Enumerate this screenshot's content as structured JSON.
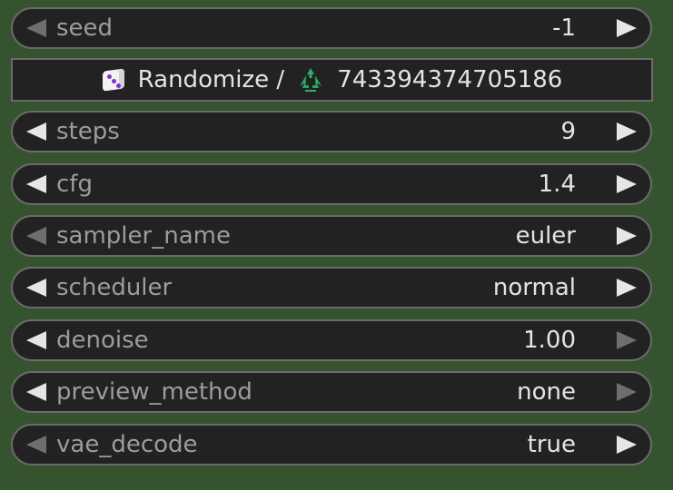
{
  "widgets": [
    {
      "name": "seed",
      "label": "seed",
      "value": "-1",
      "left_dim": true,
      "right_dim": false
    },
    {
      "name": "steps",
      "label": "steps",
      "value": "9",
      "left_dim": false,
      "right_dim": false
    },
    {
      "name": "cfg",
      "label": "cfg",
      "value": "1.4",
      "left_dim": false,
      "right_dim": false
    },
    {
      "name": "sampler-name",
      "label": "sampler_name",
      "value": "euler",
      "left_dim": true,
      "right_dim": false
    },
    {
      "name": "scheduler",
      "label": "scheduler",
      "value": "normal",
      "left_dim": false,
      "right_dim": false
    },
    {
      "name": "denoise",
      "label": "denoise",
      "value": "1.00",
      "left_dim": false,
      "right_dim": true
    },
    {
      "name": "preview-method",
      "label": "preview_method",
      "value": "none",
      "left_dim": false,
      "right_dim": true
    },
    {
      "name": "vae-decode",
      "label": "vae_decode",
      "value": "true",
      "left_dim": true,
      "right_dim": false
    }
  ],
  "randomize_button": {
    "label": "Randomize /",
    "seed_value": "743394374705186",
    "left_icon": "dice-icon",
    "right_icon": "recycle-icon"
  },
  "colors": {
    "background": "#35532f",
    "widget_bg": "#222222",
    "widget_border": "#6b6b6b",
    "label": "#9c9c9c",
    "value": "#e4e4e4",
    "arrow_active": "#e6e6e6",
    "arrow_dim": "#6e6e6e",
    "recycle_green": "#2fae6a",
    "die_pip": "#8a2bd6"
  }
}
